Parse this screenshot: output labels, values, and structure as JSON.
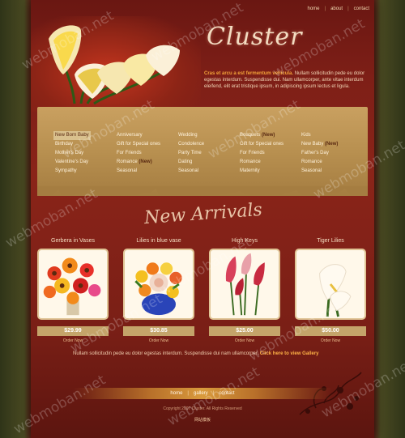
{
  "nav": {
    "home": "home",
    "about": "about",
    "contact": "contact",
    "sep": "|"
  },
  "logo": "Cluster",
  "intro": {
    "bold": "Cras et arcu a est fermentum vehicula.",
    "text": " Nullam sollicitudin pede eu dolor egestas interdum. Suspendisse dui. Nam ullamcorper, ante vitae interdum eleifend, elit erat tristique ipsum, in adipiscing ipsum lectus et ligula."
  },
  "categories": [
    [
      "New Born Baby",
      "Birthday",
      "Mother's Day",
      "Valentine's Day",
      "Sympathy"
    ],
    [
      "Anniversary",
      "Gift for Special ones",
      "For Friends",
      "Romance",
      "Seasonal"
    ],
    [
      "Wedding",
      "Condolence",
      "Party Time",
      "Dating",
      "Seasonal"
    ],
    [
      "Bouquets",
      "Gift for Special ones",
      "For Friends",
      "Romance",
      "Maternity"
    ],
    [
      "Kids",
      "New Baby",
      "Father's Day",
      "Romance",
      "Seasonal"
    ]
  ],
  "tags": {
    "new": "(New)"
  },
  "arrivals_title": "New Arrivals",
  "products": [
    {
      "name": "Gerbera in Vases",
      "price": "$29.99",
      "order": "Order Now"
    },
    {
      "name": "Lilies in blue vase",
      "price": "$30.85",
      "order": "Order Now"
    },
    {
      "name": "High Keys",
      "price": "$25.00",
      "order": "Order Now"
    },
    {
      "name": "Tiger Lilies",
      "price": "$50.00",
      "order": "Order Now"
    }
  ],
  "promo": {
    "text": "Nullam sollicitudin pede eu dolor egestas interdum. Suspendisse dui nam ullamcorper.",
    "link": "Click here to view Gallery"
  },
  "footer": {
    "home": "home",
    "gallery": "gallery",
    "contact": "contact",
    "sep": "|",
    "copyright": "Copyright 2007 Cluster. All Rights Reserved",
    "cnlogo": "网站模板"
  },
  "watermark": "webmoban.net",
  "colors": {
    "background": "#7e1f17",
    "panel": "#b89050",
    "accent": "#f2a33a"
  }
}
